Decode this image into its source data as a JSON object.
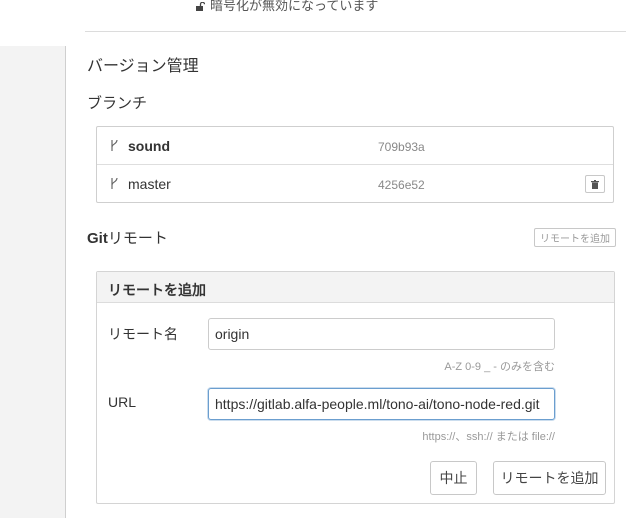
{
  "encryption": {
    "status_text": "暗号化が無効になっています",
    "icon": "unlock-icon"
  },
  "version_control": {
    "title": "バージョン管理",
    "branch_heading": "ブランチ",
    "branches": [
      {
        "name": "sound",
        "commit": "709b93a",
        "current": true
      },
      {
        "name": "master",
        "commit": "4256e52",
        "current": false
      }
    ]
  },
  "git_remote": {
    "title_prefix": "Git",
    "title_suffix": "リモート",
    "add_button_small": "リモートを追加"
  },
  "add_remote_form": {
    "header": "リモートを追加",
    "name_label": "リモート名",
    "name_value": "origin",
    "name_hint": "A-Z 0-9 _ - のみを含む",
    "url_label": "URL",
    "url_value": "https://gitlab.alfa-people.ml/tono-ai/tono-node-red.git",
    "url_hint": "https://、ssh:// または file://",
    "cancel_label": "中止",
    "submit_label": "リモートを追加"
  },
  "colors": {
    "panel_header": "#f3f3f3",
    "border": "#cfcfcf",
    "focus": "#6b9ecf"
  }
}
